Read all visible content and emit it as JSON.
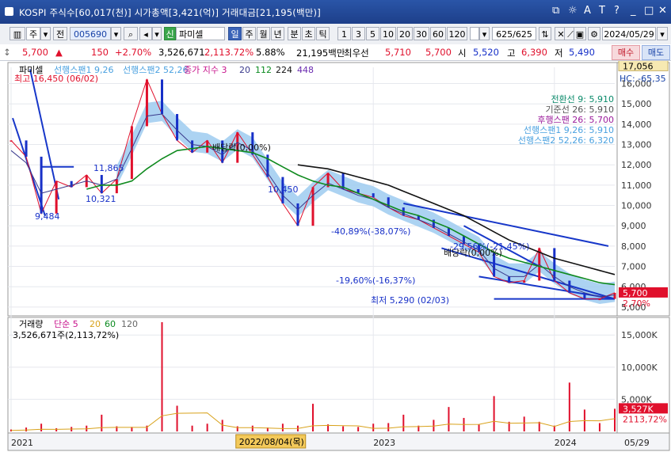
{
  "window": {
    "title": "KOSPI 주식수[60,017(천)] 시가총액[3,421(억)] 거래대금[21,195(백만)]",
    "controls": [
      "⧉",
      "☼",
      "A",
      "T",
      "?",
      "_",
      "□",
      "✕"
    ]
  },
  "toolbar": {
    "mode": "주",
    "prev_label": "전",
    "code": "005690",
    "badge": "신",
    "stock_name": "파미셀",
    "periods": [
      "일",
      "주",
      "월",
      "년",
      "분",
      "초",
      "틱"
    ],
    "active_period": "일",
    "intervals": [
      "1",
      "3",
      "5",
      "10",
      "20",
      "30",
      "60",
      "120"
    ],
    "count": "625/625",
    "date": "2024/05/29"
  },
  "quote": {
    "price": "5,700",
    "change": "150",
    "change_pct": "+2.70%",
    "volume": "3,526,671",
    "volume_ratio": "2,113.72%",
    "turnover": "5.88%",
    "amount": "21,195백만",
    "best_bid_label": "최우선",
    "best_ask": "5,710",
    "best_bid": "5,700",
    "open_label": "시",
    "open": "5,520",
    "high_label": "고",
    "high": "6,390",
    "low_label": "저",
    "low": "5,490",
    "sell_label": "매수",
    "buy_label": "매도"
  },
  "chart_data": [
    {
      "type": "line",
      "title": "파미셀",
      "legend": [
        "선행스팬1 9,26",
        "선행스팬2 52,26",
        "종가 지수 3",
        "20",
        "112",
        "224",
        "448"
      ],
      "ylim": [
        4800,
        16800
      ],
      "y_ticks": [
        "16,000",
        "15,000",
        "14,000",
        "13,000",
        "12,000",
        "11,000",
        "10,000",
        "9,000",
        "8,000",
        "7,000",
        "6,000",
        "5,000"
      ],
      "x_labels": [
        "2021",
        "2023",
        "2024",
        "05/29"
      ],
      "x_highlight": "2022/08/04(목)",
      "series": [
        {
          "name": "종가",
          "x": [
            "2021-01",
            "2021-02",
            "2021-03",
            "2021-04",
            "2021-05",
            "2021-06",
            "2021-07",
            "2021-08",
            "2021-09",
            "2021-10",
            "2021-11",
            "2021-12",
            "2022-01",
            "2022-02",
            "2022-03",
            "2022-04",
            "2022-05",
            "2022-06",
            "2022-07",
            "2022-08",
            "2022-09",
            "2022-10",
            "2022-11",
            "2022-12",
            "2023-01",
            "2023-02",
            "2023-03",
            "2023-04",
            "2023-05",
            "2023-06",
            "2023-07",
            "2023-08",
            "2023-09",
            "2023-10",
            "2023-11",
            "2023-12",
            "2024-01",
            "2024-02",
            "2024-03",
            "2024-04",
            "2024-05"
          ],
          "values": [
            13200,
            12400,
            9600,
            11200,
            10900,
            11500,
            10600,
            11300,
            13900,
            16200,
            14500,
            13200,
            12600,
            13200,
            12100,
            13600,
            12500,
            11400,
            10100,
            9000,
            10900,
            11600,
            10800,
            10600,
            10400,
            9900,
            9500,
            9300,
            8900,
            8500,
            8100,
            7700,
            6500,
            6200,
            6300,
            7900,
            6300,
            5700,
            5400,
            5400,
            5700
          ]
        },
        {
          "name": "20",
          "values": [
            12700,
            12100,
            10600,
            10800,
            11000,
            11200,
            11000,
            11300,
            12800,
            14400,
            14500,
            13700,
            13000,
            12900,
            12500,
            13100,
            12700,
            11600,
            10500,
            9800,
            10500,
            11100,
            10800,
            10500,
            10300,
            9900,
            9600,
            9300,
            9000,
            8600,
            8200,
            7800,
            6900,
            6500,
            6500,
            7100,
            6500,
            6000,
            5700,
            5500,
            5600
          ]
        },
        {
          "name": "112",
          "values": [
            null,
            null,
            null,
            null,
            null,
            10800,
            11000,
            11000,
            11200,
            11800,
            12300,
            12700,
            12800,
            12900,
            12800,
            12700,
            12600,
            12300,
            11900,
            11500,
            11200,
            11000,
            10900,
            10600,
            10300,
            10000,
            9700,
            9500,
            9200,
            8900,
            8500,
            8100,
            7700,
            7400,
            7200,
            7000,
            6800,
            6600,
            6400,
            6200,
            6100
          ]
        },
        {
          "name": "224",
          "values": [
            null,
            null,
            null,
            null,
            null,
            null,
            null,
            null,
            null,
            null,
            null,
            null,
            null,
            null,
            null,
            null,
            null,
            null,
            null,
            12000,
            11900,
            11800,
            11600,
            11400,
            11200,
            11000,
            10700,
            10400,
            10100,
            9800,
            9500,
            9100,
            8700,
            8300,
            8000,
            7700,
            7400,
            7200,
            7000,
            6800,
            6600
          ]
        }
      ],
      "annotations": [
        "최고 16,450 (06/02)",
        "최저 5,290 (02/03)",
        "배당락(0,00%)",
        "배당락(0,00%)",
        "9,484",
        "10,321",
        "11,865",
        "10,450",
        "-40,89%(-38,07%)",
        "-19,60%(-16,37%)",
        "-29,56%(-21,45%)"
      ],
      "ichimoku": {
        "전환선 9": "5,910",
        "기준선 26": "5,910",
        "후행스팬 26": "5,700",
        "선행스팬1 9,26": "5,910",
        "선행스팬2 52,26": "6,320"
      },
      "current_price_label": "5,700",
      "current_change_label": "2,70%",
      "top_price_box": "17,056",
      "hc_label": "HC: -65,35"
    },
    {
      "type": "bar",
      "title": "거래량",
      "legend": [
        "단순 5",
        "20",
        "60",
        "120"
      ],
      "value_label": "3,526,671주(2,113,72%)",
      "y_ticks": [
        "15,000K",
        "10,000K",
        "5,000K"
      ],
      "ylim": [
        0,
        17000
      ],
      "values": [
        300,
        600,
        1200,
        500,
        700,
        900,
        2600,
        800,
        700,
        900,
        17000,
        4000,
        900,
        1200,
        1800,
        800,
        900,
        600,
        1200,
        900,
        4300,
        1100,
        800,
        700,
        1200,
        1300,
        2600,
        900,
        1800,
        3800,
        2100,
        1100,
        5500,
        1500,
        2300,
        1500,
        900,
        7600,
        3400,
        1300,
        3527
      ],
      "current_value_label": "3,527K",
      "current_ratio_label": "2113,72%"
    }
  ],
  "colors": {
    "up": "#e0102c",
    "down": "#1730c8",
    "ma20": "#3a3a8c",
    "ma112": "#0f8a1e",
    "ma224": "#111111",
    "cloud": "#9ecbf0",
    "trendline": "#1737c9",
    "volume": "#e0102c"
  }
}
